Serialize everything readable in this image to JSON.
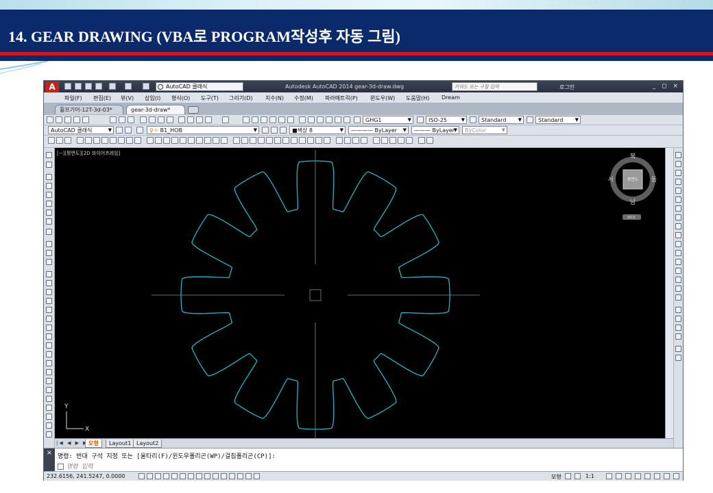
{
  "slide": {
    "title": "14.  GEAR DRAWING (VBA로 PROGRAM작성후 자동 그림)"
  },
  "autocad": {
    "workspace": "AutoCAD 클래식",
    "window_title": "Autodesk AutoCAD 2014    gear-3d-draw.dwg",
    "search_placeholder": "키워드 또는 구절 입력",
    "login": "로그인",
    "window_controls": "_ ◻ ×",
    "menu": [
      "파일(F)",
      "편집(E)",
      "뷰(V)",
      "삽입(I)",
      "형식(O)",
      "도구(T)",
      "그리기(D)",
      "치수(N)",
      "수정(M)",
      "파라메트릭(P)",
      "윈도우(W)",
      "도움말(H)",
      "Dream"
    ],
    "doc_tabs": [
      "휠프기어-12T-3d-03*",
      "gear-3d-draw*"
    ],
    "toolbar": {
      "text_style": "GHG1",
      "dim_style": "ISO-25",
      "table_style": "Standard",
      "multileader_style": "Standard",
      "workspace_combo": "AutoCAD 클래식",
      "layer": "B1_HOB",
      "color": "■색상 8",
      "linetype": "———— ByLayer",
      "lineweight": "——— ByLayer",
      "plotstyle": "ByColor"
    },
    "viewport_label": "[−][평면도][2D 와이어프레임]",
    "viewcube": {
      "north": "북",
      "south": "남",
      "east": "동",
      "west": "서",
      "face": "평면도",
      "wcs": "WCS"
    },
    "ucs": {
      "x": "X",
      "y": "Y"
    },
    "gear": {
      "teeth": 12,
      "color": "#1fb8c8"
    },
    "layout_tabs": [
      "모형",
      "Layout1",
      "Layout2"
    ],
    "layout_arrows": "|◀ ◀ ▶ ▶|",
    "command_history": "명령: 반대 구석 지정 또는 [울타리(F)/윈도우폴리곤(WP)/걸침폴리곤(CP)]:",
    "command_input": "명령 입력",
    "cmd_side": "×",
    "coordinates": "232.6156, 241.5247, 0.0000",
    "status_model": "모형",
    "status_scale": "1:1"
  }
}
